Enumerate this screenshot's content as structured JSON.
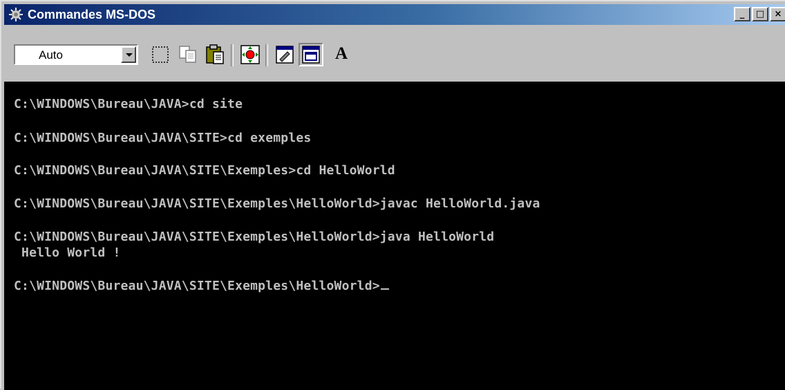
{
  "window": {
    "title": "Commandes MS-DOS"
  },
  "title_buttons": {
    "minimize": "_",
    "maximize": "□",
    "close": "×"
  },
  "toolbar": {
    "font_select_value": "Auto",
    "tools": [
      "mark-icon",
      "copy-icon",
      "paste-icon",
      "fullscreen-icon",
      "properties-icon",
      "background-icon",
      "font-icon"
    ],
    "font_button_label": "A"
  },
  "console": {
    "lines": [
      "C:\\WINDOWS\\Bureau\\JAVA>cd site",
      "C:\\WINDOWS\\Bureau\\JAVA\\SITE>cd exemples",
      "C:\\WINDOWS\\Bureau\\JAVA\\SITE\\Exemples>cd HelloWorld",
      "C:\\WINDOWS\\Bureau\\JAVA\\SITE\\Exemples\\HelloWorld>javac HelloWorld.java",
      "C:\\WINDOWS\\Bureau\\JAVA\\SITE\\Exemples\\HelloWorld>java HelloWorld",
      " Hello World !",
      "C:\\WINDOWS\\Bureau\\JAVA\\SITE\\Exemples\\HelloWorld>"
    ]
  },
  "colors": {
    "console_bg": "#000000",
    "console_fg": "#c0c0c0",
    "title_start": "#0a246a",
    "title_end": "#a6caf0"
  }
}
